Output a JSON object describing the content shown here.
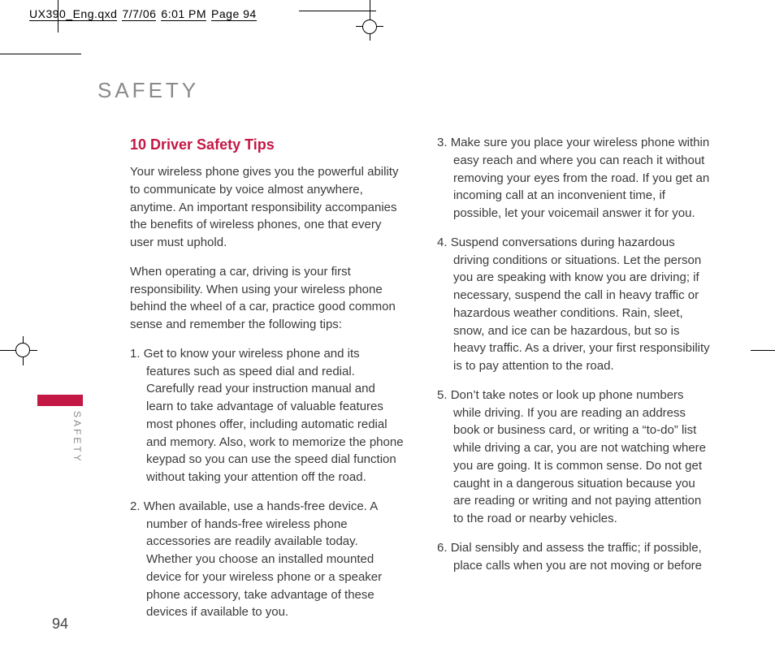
{
  "slug": {
    "filename": "UX390_Eng.qxd",
    "date": "7/7/06",
    "time": "6:01 PM",
    "page_label": "Page 94"
  },
  "running_head": "SAFETY",
  "side_tab": "SAFETY",
  "folio": "94",
  "section_title": "10 Driver Safety Tips",
  "intro": [
    "Your wireless phone gives you the powerful ability to communicate by voice almost anywhere, anytime. An important responsibility accompanies the benefits of wireless phones, one that every user must uphold.",
    "When operating a car, driving is your first responsibility. When using your wireless phone behind the wheel of a car, practice good common sense and remember the following tips:"
  ],
  "tips": [
    "Get to know your wireless phone and its features such as speed dial and redial. Carefully read your instruction manual and learn to take advantage of valuable features most phones offer, including automatic redial and memory. Also, work to memorize the phone keypad so you can use the speed dial function without taking your attention off the road.",
    "When available, use a hands-free device. A number of hands-free wireless phone accessories are readily available today. Whether you choose an installed mounted device for your wireless phone or a speaker phone accessory, take advantage of these devices if available to you.",
    "Make sure you place your wireless phone within easy reach and where you can reach it without removing your eyes from the road. If you get an incoming call at an inconvenient time, if possible, let your voicemail answer it for you.",
    "Suspend conversations during hazardous driving conditions or situations. Let the person you are speaking with know you are driving; if necessary, suspend the call in heavy traffic or hazardous weather conditions. Rain, sleet, snow, and ice can be hazardous, but so is heavy traffic. As a driver, your first responsibility is to pay attention to the road.",
    "Don’t take notes or look up phone numbers while driving. If you are reading an address book or business card, or writing a “to-do” list while driving a car, you are not watching where you are going. It is common sense. Do not get caught in a dangerous situation because you are reading or writing and not paying attention to the road or nearby vehicles.",
    "Dial sensibly and assess the traffic; if possible, place calls when you are not moving or before"
  ]
}
